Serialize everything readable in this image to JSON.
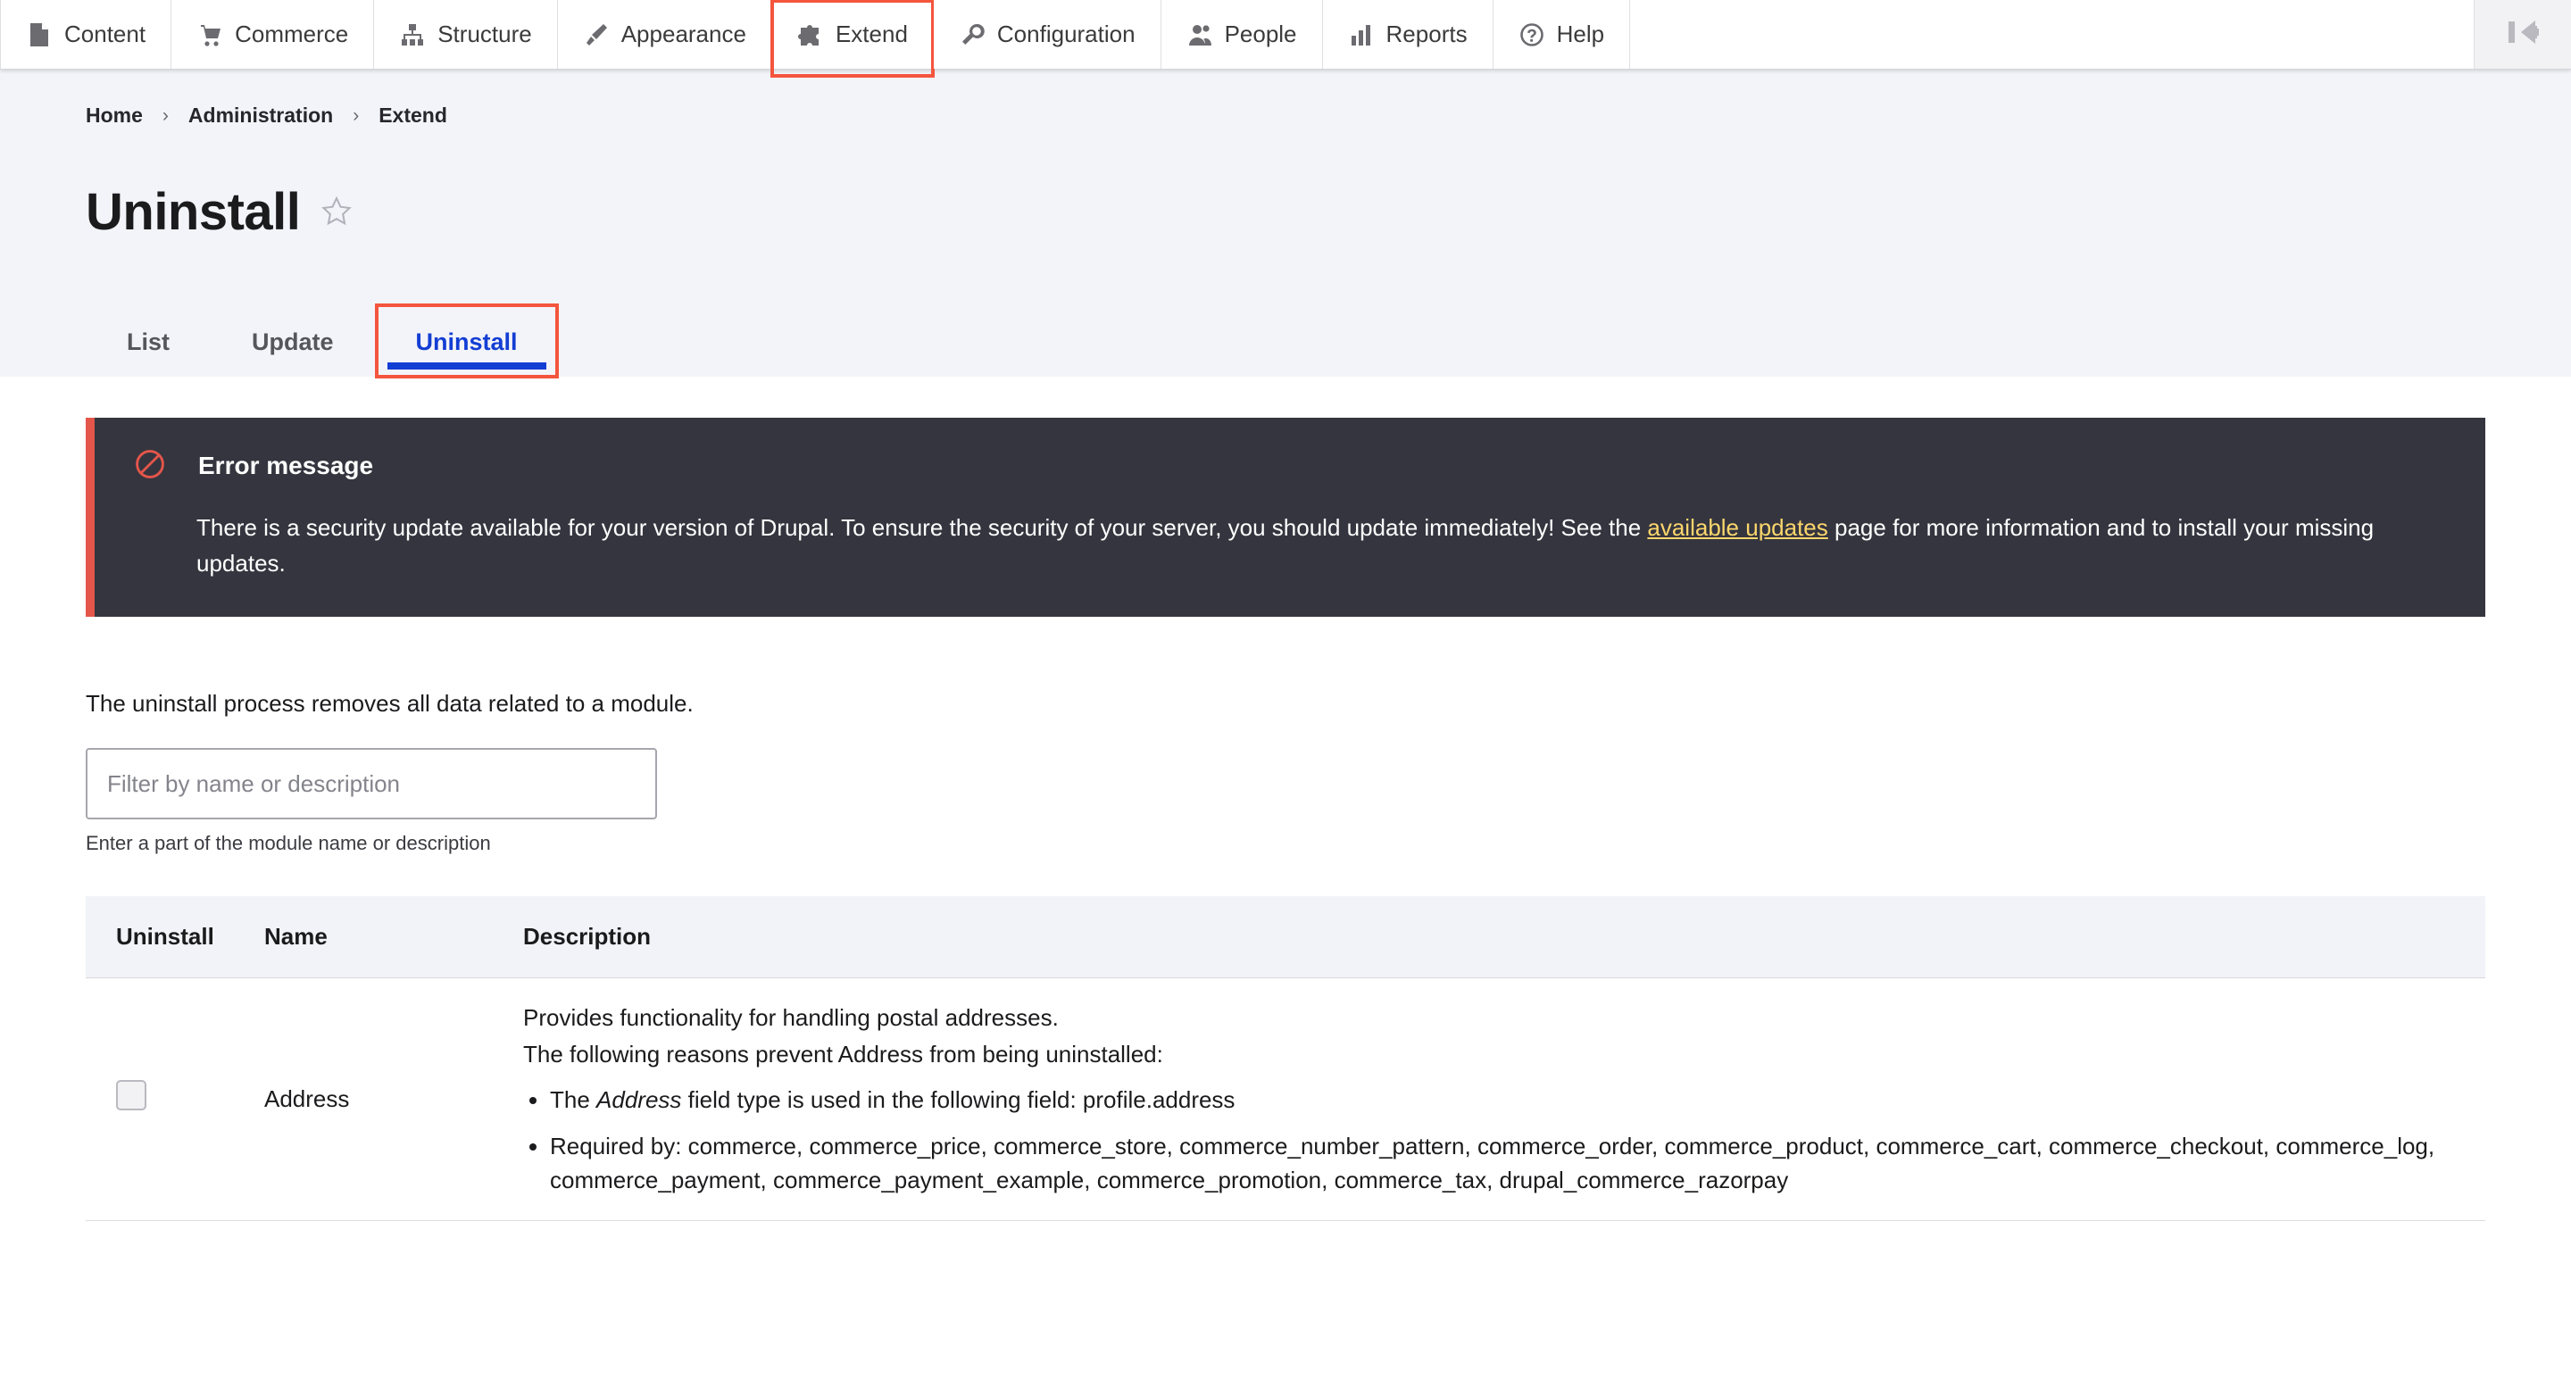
{
  "toolbar": {
    "items": [
      {
        "label": "Content",
        "icon": "document-icon",
        "highlighted": false
      },
      {
        "label": "Commerce",
        "icon": "shopping-cart-icon",
        "highlighted": false
      },
      {
        "label": "Structure",
        "icon": "sitemap-icon",
        "highlighted": false
      },
      {
        "label": "Appearance",
        "icon": "paintbrush-icon",
        "highlighted": false
      },
      {
        "label": "Extend",
        "icon": "puzzle-piece-icon",
        "highlighted": true
      },
      {
        "label": "Configuration",
        "icon": "wrench-icon",
        "highlighted": false
      },
      {
        "label": "People",
        "icon": "people-icon",
        "highlighted": false
      },
      {
        "label": "Reports",
        "icon": "bar-chart-icon",
        "highlighted": false
      },
      {
        "label": "Help",
        "icon": "question-mark-icon",
        "highlighted": false
      }
    ],
    "collapse_icon": "collapse-toolbar-icon"
  },
  "breadcrumb": {
    "items": [
      "Home",
      "Administration",
      "Extend"
    ],
    "separator": "›"
  },
  "page": {
    "title": "Uninstall",
    "star_icon": "star-outline-icon"
  },
  "tabs": [
    {
      "label": "List",
      "active": false,
      "highlighted": false
    },
    {
      "label": "Update",
      "active": false,
      "highlighted": false
    },
    {
      "label": "Uninstall",
      "active": true,
      "highlighted": true
    }
  ],
  "message": {
    "icon": "error-prohibited-icon",
    "title": "Error message",
    "text_before": "There is a security update available for your version of Drupal. To ensure the security of your server, you should update immediately! See the ",
    "link_text": "available updates",
    "text_after": " page for more information and to install your missing updates.",
    "accent_color": "#e4564a",
    "background_color": "#35353f",
    "link_color": "#fbd66c"
  },
  "intro": "The uninstall process removes all data related to a module.",
  "filter": {
    "placeholder": "Filter by name or description",
    "value": "",
    "help": "Enter a part of the module name or description"
  },
  "table": {
    "headers": [
      "Uninstall",
      "Name",
      "Description"
    ],
    "rows": [
      {
        "checked": false,
        "name": "Address",
        "description": "Provides functionality for handling postal addresses.",
        "reasons_intro": "The following reasons prevent Address from being uninstalled:",
        "reasons": [
          {
            "prefix": "The ",
            "emphasis": "Address",
            "suffix": " field type is used in the following field: profile.address"
          },
          {
            "prefix": "Required by: commerce, commerce_price, commerce_store, commerce_number_pattern, commerce_order, commerce_product, commerce_cart, commerce_checkout, commerce_log, commerce_payment, commerce_payment_example, commerce_promotion, commerce_tax, drupal_commerce_razorpay",
            "emphasis": "",
            "suffix": ""
          }
        ]
      }
    ]
  },
  "colors": {
    "tab_active": "#133ed4",
    "highlight_box": "#f4553d",
    "header_bg": "#f3f4f9"
  }
}
